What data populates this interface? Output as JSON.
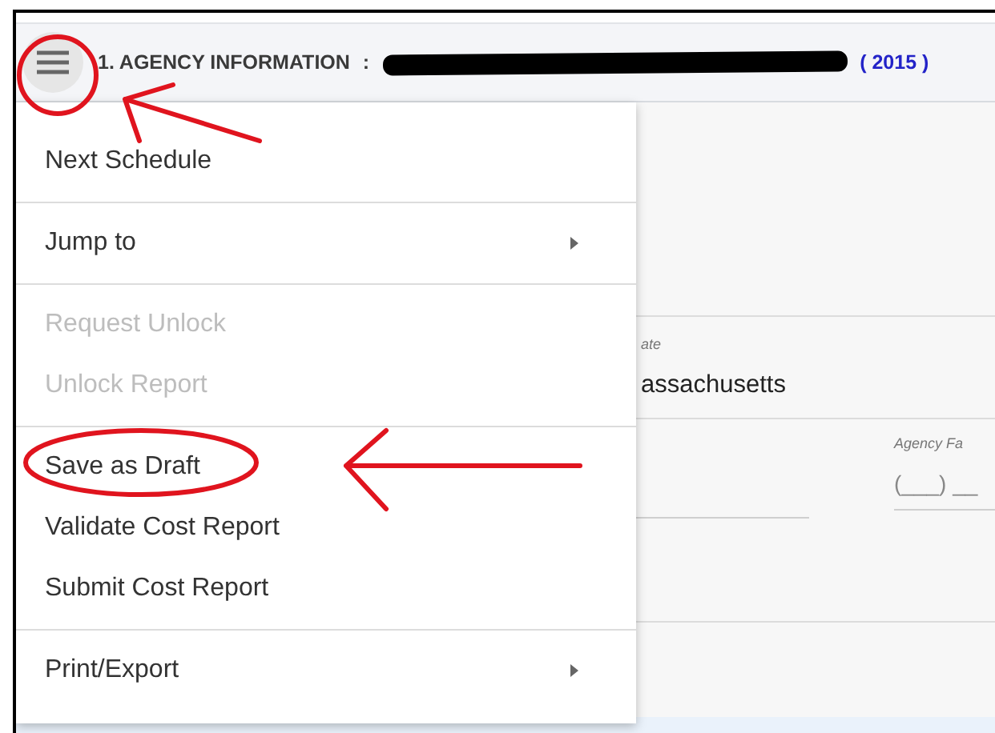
{
  "header": {
    "title": "1. AGENCY INFORMATION",
    "separator": ":",
    "year": "( 2015 )"
  },
  "form": {
    "fields": [
      {
        "label": "ate",
        "value": "assachusetts"
      },
      {
        "label": "Agency Fa",
        "placeholder": "(___) __"
      }
    ]
  },
  "menu": {
    "groups": [
      {
        "items": [
          {
            "label": "Next Schedule",
            "disabled": false,
            "submenu": false
          }
        ]
      },
      {
        "items": [
          {
            "label": "Jump to",
            "disabled": false,
            "submenu": true
          }
        ]
      },
      {
        "items": [
          {
            "label": "Request Unlock",
            "disabled": true,
            "submenu": false
          },
          {
            "label": "Unlock Report",
            "disabled": true,
            "submenu": false
          }
        ]
      },
      {
        "items": [
          {
            "label": "Save as Draft",
            "disabled": false,
            "submenu": false
          },
          {
            "label": "Validate Cost Report",
            "disabled": false,
            "submenu": false
          },
          {
            "label": "Submit Cost Report",
            "disabled": false,
            "submenu": false
          }
        ]
      },
      {
        "items": [
          {
            "label": "Print/Export",
            "disabled": false,
            "submenu": true
          }
        ]
      }
    ]
  }
}
